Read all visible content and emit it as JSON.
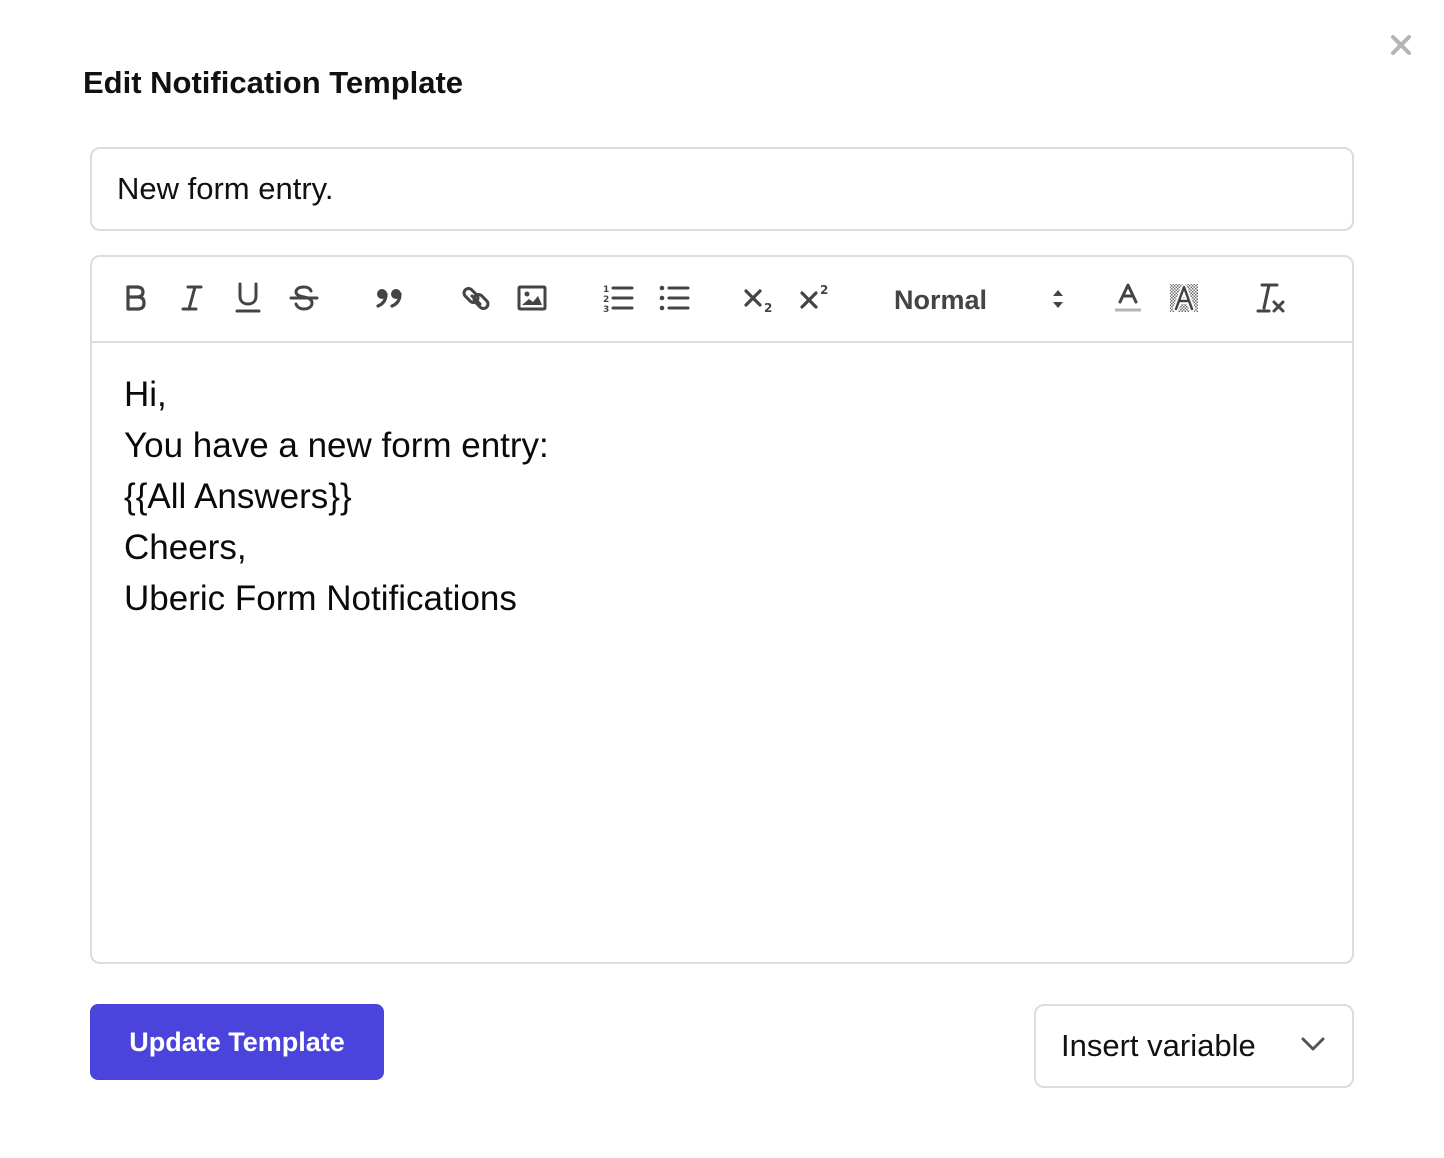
{
  "modal": {
    "title": "Edit Notification Template",
    "close_icon": "close-icon"
  },
  "subject": {
    "value": "New form entry."
  },
  "toolbar": {
    "buttons": [
      {
        "name": "bold",
        "icon": "bold-icon"
      },
      {
        "name": "italic",
        "icon": "italic-icon"
      },
      {
        "name": "underline",
        "icon": "underline-icon"
      },
      {
        "name": "strike",
        "icon": "strikethrough-icon"
      },
      {
        "name": "blockquote",
        "icon": "quote-icon"
      },
      {
        "name": "link",
        "icon": "link-icon"
      },
      {
        "name": "image",
        "icon": "image-icon"
      },
      {
        "name": "ordered-list",
        "icon": "ordered-list-icon"
      },
      {
        "name": "bullet-list",
        "icon": "bullet-list-icon"
      },
      {
        "name": "subscript",
        "icon": "subscript-icon"
      },
      {
        "name": "superscript",
        "icon": "superscript-icon"
      },
      {
        "name": "font-color",
        "icon": "text-color-icon"
      },
      {
        "name": "background-color",
        "icon": "highlight-color-icon"
      },
      {
        "name": "clear-format",
        "icon": "clear-formatting-icon"
      }
    ],
    "font_size": {
      "selected": "Normal"
    }
  },
  "body": {
    "lines": [
      "Hi,",
      "You have a new form entry:",
      "{{All Answers}}",
      "Cheers,",
      "Uberic Form Notifications"
    ]
  },
  "actions": {
    "update_label": "Update Template",
    "insert_variable_label": "Insert variable"
  },
  "colors": {
    "primary": "#4a44dd",
    "border": "#dcdcdc",
    "icon": "#444444",
    "close": "#b5b5b5"
  }
}
